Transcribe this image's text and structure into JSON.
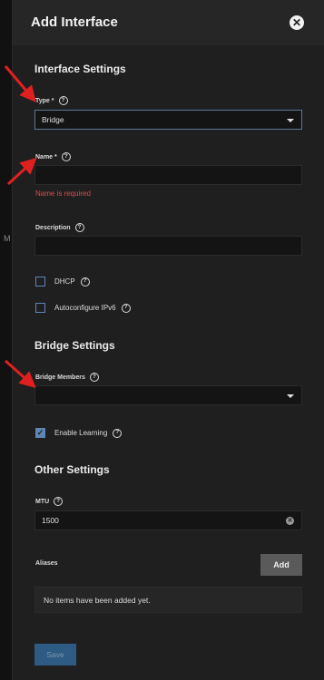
{
  "backdrop": {
    "glyph": "M"
  },
  "dialog": {
    "title": "Add Interface"
  },
  "interface_settings": {
    "heading": "Interface Settings",
    "type": {
      "label": "Type *",
      "value": "Bridge"
    },
    "name": {
      "label": "Name *",
      "value": "",
      "error": "Name is required"
    },
    "description": {
      "label": "Description",
      "value": ""
    },
    "dhcp": {
      "label": "DHCP",
      "checked": false
    },
    "autoconfigure_ipv6": {
      "label": "Autoconfigure IPv6",
      "checked": false
    }
  },
  "bridge_settings": {
    "heading": "Bridge Settings",
    "bridge_members": {
      "label": "Bridge Members",
      "value": ""
    },
    "enable_learning": {
      "label": "Enable Learning",
      "checked": true
    }
  },
  "other_settings": {
    "heading": "Other Settings",
    "mtu": {
      "label": "MTU",
      "value": "1500"
    },
    "aliases": {
      "label": "Aliases",
      "add_label": "Add",
      "empty_text": "No items have been added yet."
    }
  },
  "actions": {
    "save_label": "Save"
  },
  "colors": {
    "panel": "#1f1f1f",
    "accent": "#5d86b6",
    "error": "#e04b4b",
    "annotation_arrow": "#e02020",
    "save_button": "#2e5b83"
  }
}
